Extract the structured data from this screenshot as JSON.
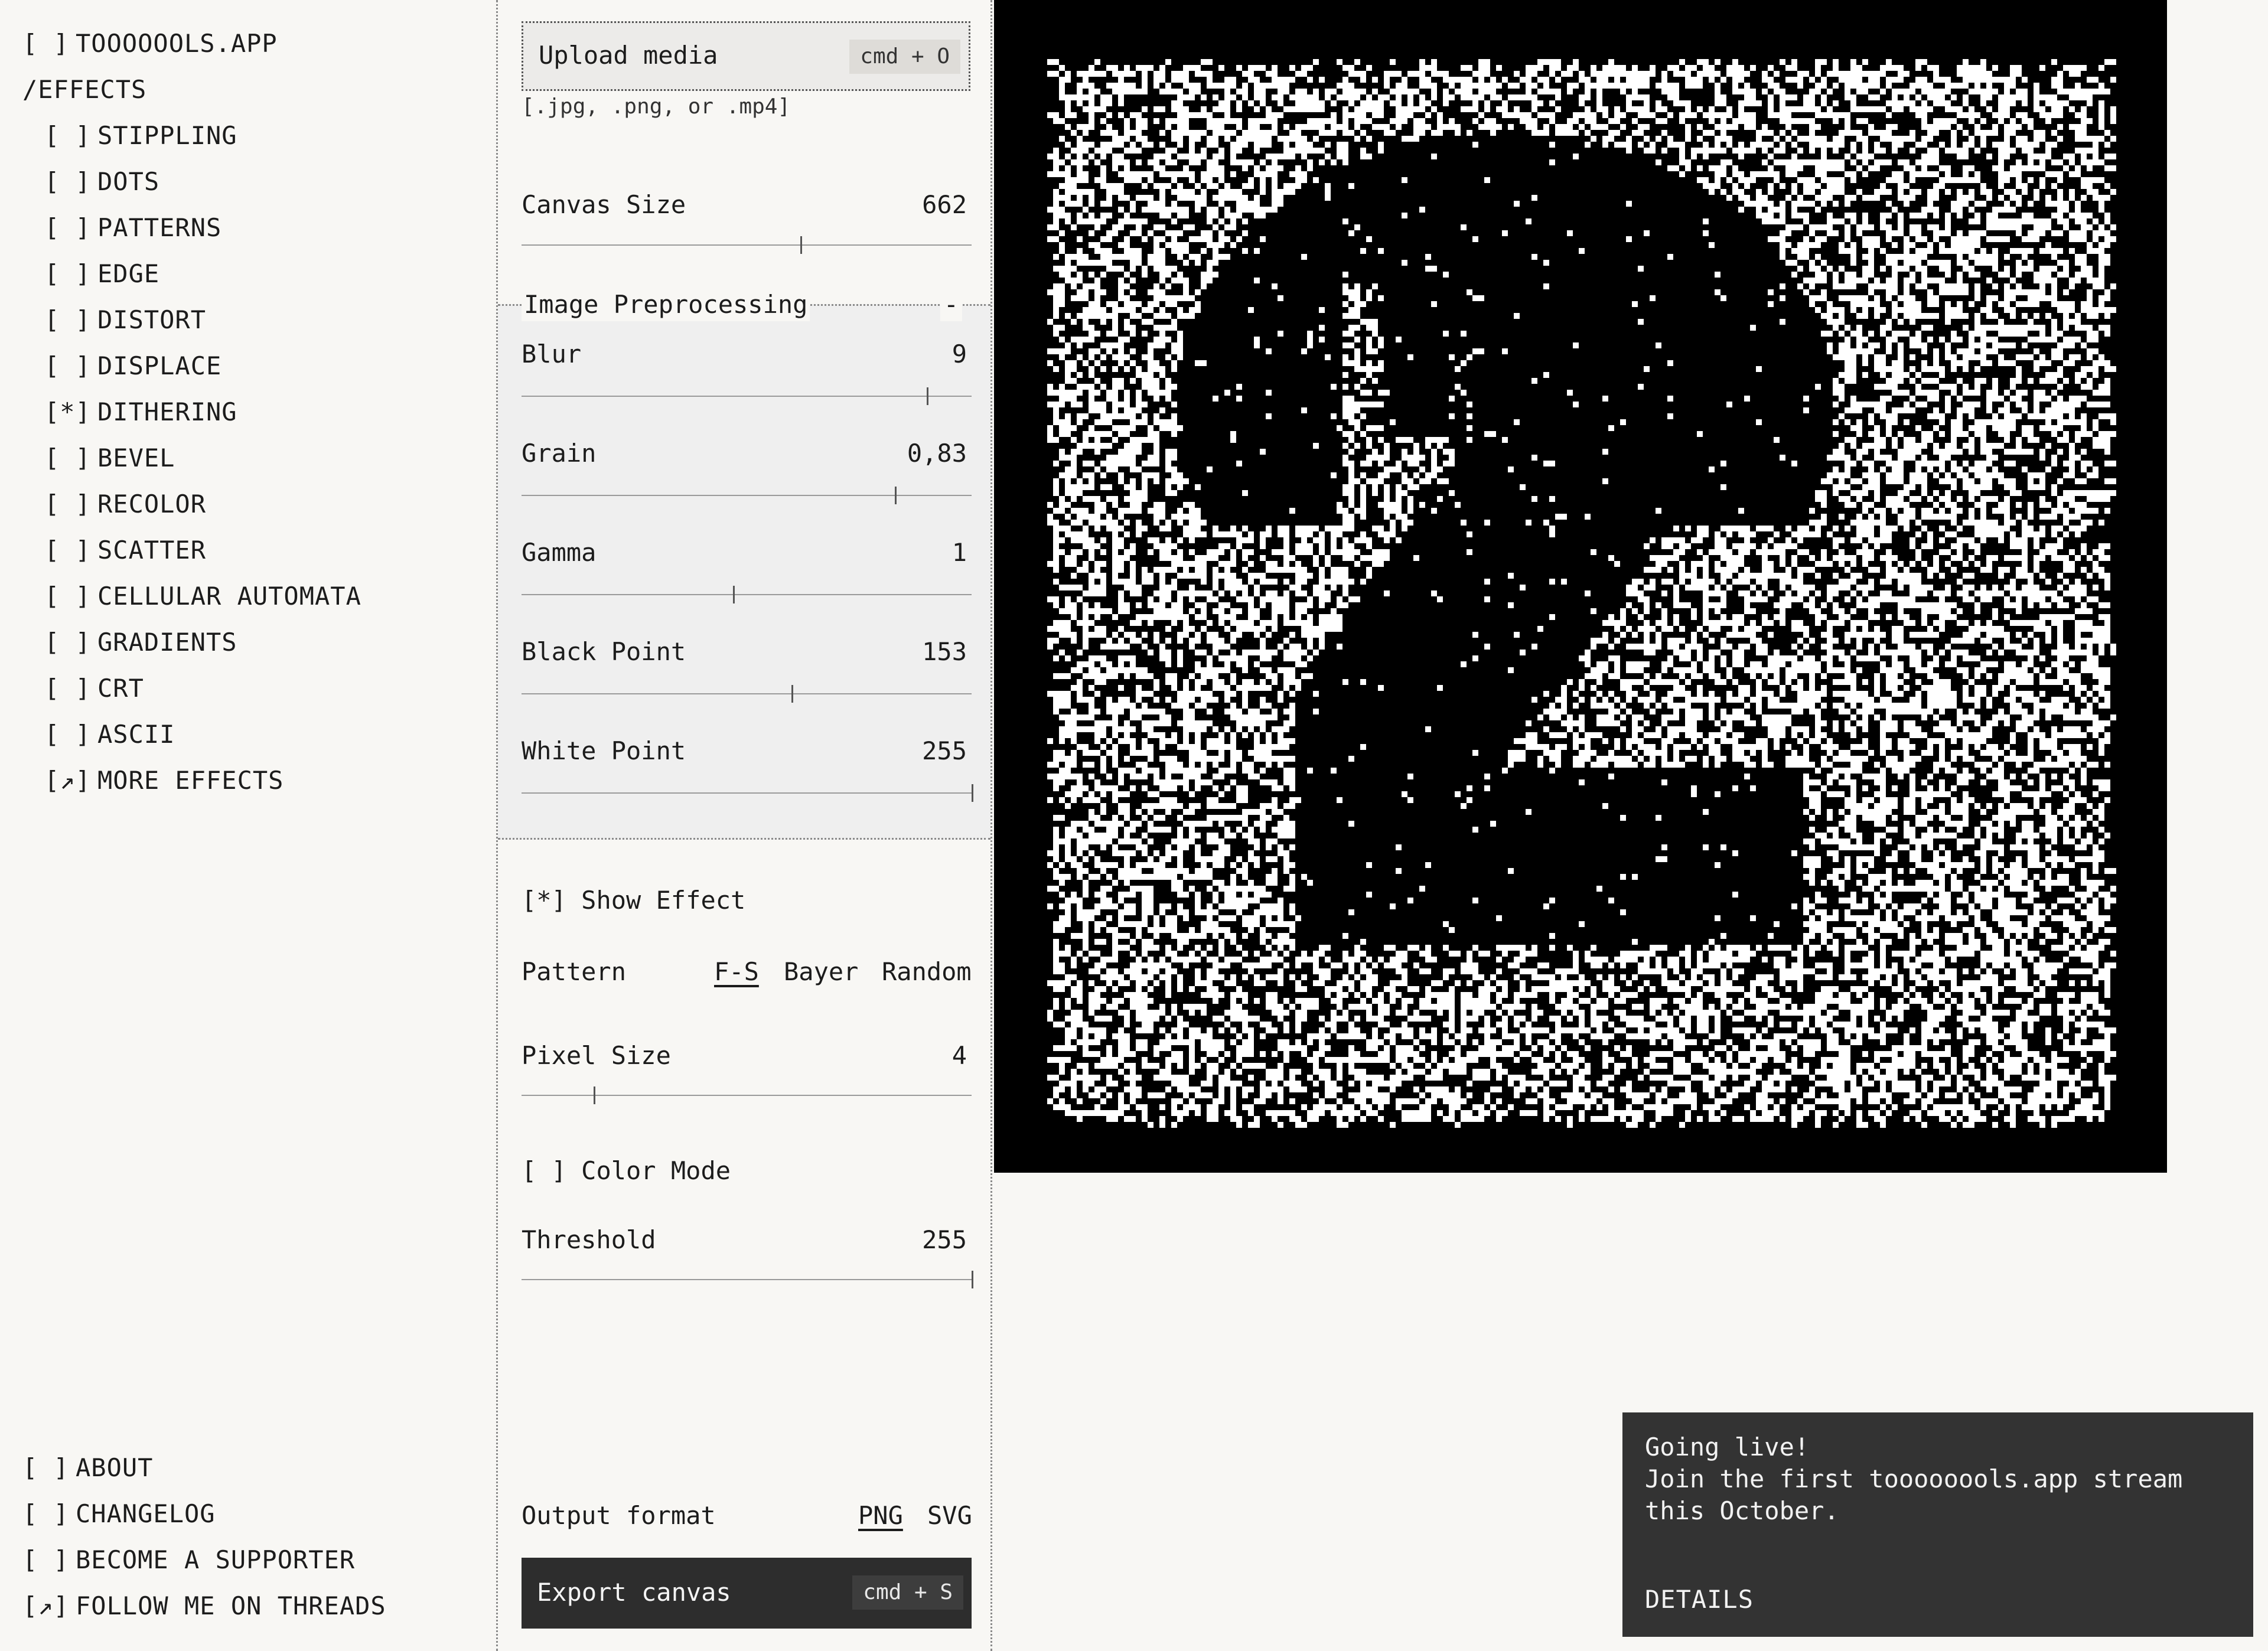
{
  "nav": {
    "app": {
      "mark": "[ ]",
      "label": "TOOOOOOLS.APP"
    },
    "section": "/EFFECTS",
    "effects": [
      {
        "mark": "[ ]",
        "label": "STIPPLING"
      },
      {
        "mark": "[ ]",
        "label": "DOTS"
      },
      {
        "mark": "[ ]",
        "label": "PATTERNS"
      },
      {
        "mark": "[ ]",
        "label": "EDGE"
      },
      {
        "mark": "[ ]",
        "label": "DISTORT"
      },
      {
        "mark": "[ ]",
        "label": "DISPLACE"
      },
      {
        "mark": "[*]",
        "label": "DITHERING"
      },
      {
        "mark": "[ ]",
        "label": "BEVEL"
      },
      {
        "mark": "[ ]",
        "label": "RECOLOR"
      },
      {
        "mark": "[ ]",
        "label": "SCATTER"
      },
      {
        "mark": "[ ]",
        "label": "CELLULAR AUTOMATA"
      },
      {
        "mark": "[ ]",
        "label": "GRADIENTS"
      },
      {
        "mark": "[ ]",
        "label": "CRT"
      },
      {
        "mark": "[ ]",
        "label": "ASCII"
      },
      {
        "mark": "[↗]",
        "label": "MORE EFFECTS"
      }
    ],
    "footer": [
      {
        "mark": "[ ]",
        "label": "ABOUT"
      },
      {
        "mark": "[ ]",
        "label": "CHANGELOG"
      },
      {
        "mark": "[ ]",
        "label": "BECOME A SUPPORTER"
      },
      {
        "mark": "[↗]",
        "label": "FOLLOW ME ON THREADS"
      }
    ]
  },
  "panel": {
    "upload": {
      "label": "Upload media",
      "shortcut": "cmd + O",
      "hint": "[.jpg, .png, or .mp4]"
    },
    "canvas_size": {
      "label": "Canvas Size",
      "value": "662",
      "level": 0.62
    },
    "preprocessing": {
      "title": "Image Preprocessing",
      "collapse": "-",
      "blur": {
        "label": "Blur",
        "value": "9",
        "level": 0.9
      },
      "grain": {
        "label": "Grain",
        "value": "0,83",
        "level": 0.83
      },
      "gamma": {
        "label": "Gamma",
        "value": "1",
        "level": 0.47
      },
      "black_point": {
        "label": "Black Point",
        "value": "153",
        "level": 0.6
      },
      "white_point": {
        "label": "White Point",
        "value": "255",
        "level": 1.0
      }
    },
    "show_effect": {
      "mark": "[*]",
      "label": "Show Effect"
    },
    "pattern": {
      "label": "Pattern",
      "options": [
        "F-S",
        "Bayer",
        "Random"
      ],
      "selected": "F-S"
    },
    "pixel_size": {
      "label": "Pixel Size",
      "value": "4",
      "level": 0.16
    },
    "color_mode": {
      "mark": "[ ]",
      "label": "Color Mode"
    },
    "threshold": {
      "label": "Threshold",
      "value": "255",
      "level": 1.0
    },
    "output": {
      "label": "Output format",
      "options": [
        "PNG",
        "SVG"
      ],
      "selected": "PNG"
    },
    "export": {
      "label": "Export canvas",
      "shortcut": "cmd + S"
    }
  },
  "toast": {
    "title": "Going live!",
    "body": "Join the first toooooools.app stream this October.",
    "link": "DETAILS"
  },
  "colors": {
    "background": "#f8f7f4",
    "canvas": "#000000",
    "toast": "#333333",
    "text": "#1c1c1c"
  }
}
